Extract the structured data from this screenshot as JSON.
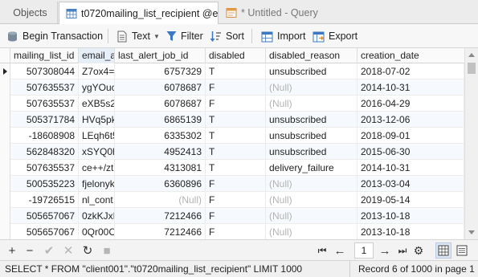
{
  "tabs": [
    {
      "label": "Objects"
    },
    {
      "label": "t0720mailing_list_recipient @e..."
    },
    {
      "label": "* Untitled - Query"
    }
  ],
  "toolbar": {
    "begin_transaction": "Begin Transaction",
    "text": "Text",
    "filter": "Filter",
    "sort": "Sort",
    "import": "Import",
    "export": "Export"
  },
  "grid": {
    "columns": [
      "mailing_list_id",
      "email_a",
      "last_alert_job_id",
      "disabled",
      "disabled_reason",
      "creation_date"
    ],
    "rows": [
      {
        "mailing_list_id": "507308044",
        "email": "Z7ox4=",
        "last_alert_job_id": "6757329",
        "disabled": "T",
        "disabled_reason": "unsubscribed",
        "creation_date": "2018-07-02"
      },
      {
        "mailing_list_id": "507635537",
        "email": "ygYOuc",
        "last_alert_job_id": "6078687",
        "disabled": "F",
        "disabled_reason": "(Null)",
        "creation_date": "2014-10-31"
      },
      {
        "mailing_list_id": "507635537",
        "email": "eXB5s2j",
        "last_alert_job_id": "6078687",
        "disabled": "F",
        "disabled_reason": "(Null)",
        "creation_date": "2016-04-29"
      },
      {
        "mailing_list_id": "505371784",
        "email": "HVq5pk",
        "last_alert_job_id": "6865139",
        "disabled": "T",
        "disabled_reason": "unsubscribed",
        "creation_date": "2013-12-06"
      },
      {
        "mailing_list_id": "-18608908",
        "email": "LEqh6t5",
        "last_alert_job_id": "6335302",
        "disabled": "T",
        "disabled_reason": "unsubscribed",
        "creation_date": "2018-09-01"
      },
      {
        "mailing_list_id": "562848320",
        "email": "xSYQ0h",
        "last_alert_job_id": "4952413",
        "disabled": "T",
        "disabled_reason": "unsubscribed",
        "creation_date": "2015-06-30"
      },
      {
        "mailing_list_id": "507635537",
        "email": "ce++/zt",
        "last_alert_job_id": "4313081",
        "disabled": "T",
        "disabled_reason": "delivery_failure",
        "creation_date": "2014-10-31"
      },
      {
        "mailing_list_id": "500535223",
        "email": "fjelonyk",
        "last_alert_job_id": "6360896",
        "disabled": "F",
        "disabled_reason": "(Null)",
        "creation_date": "2013-03-04"
      },
      {
        "mailing_list_id": "-19726515",
        "email": "nl_cont",
        "last_alert_job_id": "(Null)",
        "disabled": "F",
        "disabled_reason": "(Null)",
        "creation_date": "2019-05-14"
      },
      {
        "mailing_list_id": "505657067",
        "email": "0zkKJxL",
        "last_alert_job_id": "7212466",
        "disabled": "F",
        "disabled_reason": "(Null)",
        "creation_date": "2013-10-18"
      },
      {
        "mailing_list_id": "505657067",
        "email": "0Qr00C",
        "last_alert_job_id": "7212466",
        "disabled": "F",
        "disabled_reason": "(Null)",
        "creation_date": "2013-10-18"
      }
    ]
  },
  "nav": {
    "page": "1"
  },
  "status": {
    "sql": "SELECT * FROM \"client001\".\"t0720mailing_list_recipient\" LIMIT 1000",
    "record": "Record 6 of 1000 in page 1"
  }
}
